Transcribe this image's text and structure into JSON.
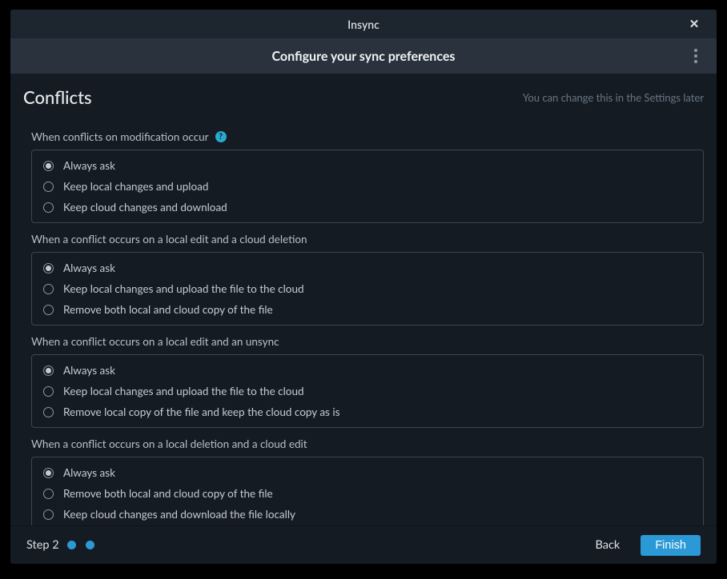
{
  "window": {
    "title": "Insync",
    "close_glyph": "✕"
  },
  "subheader": {
    "title": "Configure your sync preferences"
  },
  "section": {
    "title": "Conflicts",
    "hint": "You can change this in the Settings later"
  },
  "groups": [
    {
      "label": "When conflicts on modification occur",
      "help": true,
      "selected": 0,
      "options": [
        "Always ask",
        "Keep local changes and upload",
        "Keep cloud changes and download"
      ]
    },
    {
      "label": "When a conflict occurs on a local edit and a cloud deletion",
      "help": false,
      "selected": 0,
      "options": [
        "Always ask",
        "Keep local changes and upload the file to the cloud",
        "Remove both local and cloud copy of the file"
      ]
    },
    {
      "label": "When a conflict occurs on a local edit and an unsync",
      "help": false,
      "selected": 0,
      "options": [
        "Always ask",
        "Keep local changes and upload the file to the cloud",
        "Remove local copy of the file and keep the cloud copy as is"
      ]
    },
    {
      "label": "When a conflict occurs on a local deletion and a cloud edit",
      "help": false,
      "selected": 0,
      "options": [
        "Always ask",
        "Remove both local and cloud copy of the file",
        "Keep cloud changes and download the file locally"
      ]
    }
  ],
  "footer": {
    "step_label": "Step 2",
    "back": "Back",
    "finish": "Finish"
  },
  "help_glyph": "?"
}
